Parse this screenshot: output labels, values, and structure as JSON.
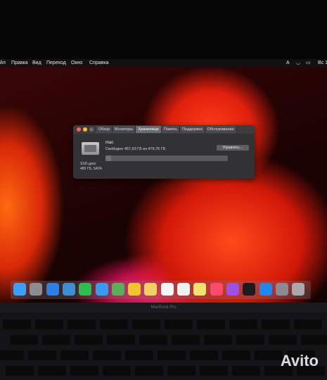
{
  "menubar": {
    "items": [
      "йл",
      "Правка",
      "Вид",
      "Переход",
      "Окно",
      "Справка"
    ],
    "right": {
      "clock": "Вс 1"
    }
  },
  "window": {
    "tabs": [
      "Обзор",
      "Мониторы",
      "Хранилище",
      "Память",
      "Поддержка",
      "Обслуживание"
    ],
    "active_tab": "Хранилище",
    "disk_name": "mac",
    "free_text": "Свободно 457,93 ГБ из 479,76 ГБ",
    "manage_button": "Управлять…",
    "disk_type": "SSD-диск",
    "disk_info": "480 ГБ, SATA",
    "used_fraction": 0.045
  },
  "dock": {
    "icons": [
      "finder-icon",
      "launchpad-icon",
      "safari-icon",
      "preview-icon",
      "facetime-icon",
      "messages-icon",
      "maps-icon",
      "photos-icon",
      "notes-icon",
      "calendar-icon",
      "reminders-icon",
      "stickies-icon",
      "music-icon",
      "podcasts-icon",
      "tv-icon",
      "appstore-icon",
      "system-preferences-icon",
      "trash-icon"
    ]
  },
  "laptop": {
    "brand": "MacBook Pro"
  },
  "watermark": "Avito",
  "colors": {
    "window_bg": "#323234",
    "accent": "#6a6a70"
  }
}
